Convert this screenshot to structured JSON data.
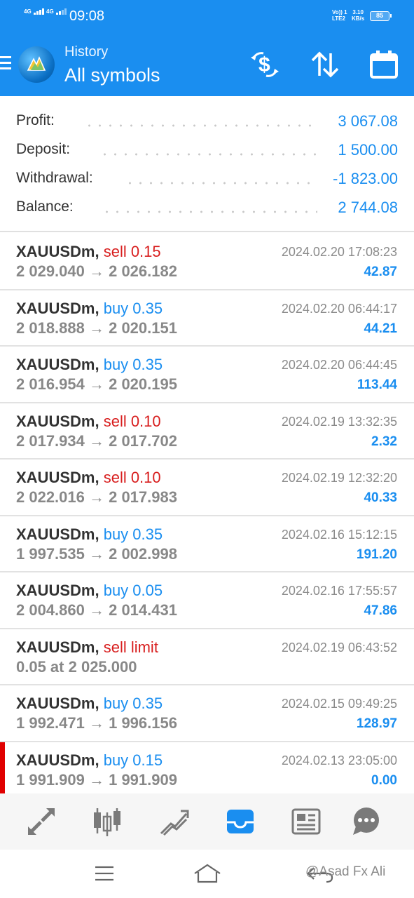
{
  "status_bar": {
    "signal1": "4G",
    "signal2": "4G",
    "time": "09:08",
    "volte": "Vo)) 1",
    "lte": "LTE2",
    "speed_value": "3.10",
    "speed_unit": "KB/s",
    "battery": "85"
  },
  "header": {
    "subtitle": "History",
    "title": "All symbols",
    "accent_color": "#1a8ef0",
    "icons": [
      "menu-icon",
      "app-logo",
      "deposit-exchange-icon",
      "sort-icon",
      "calendar-icon"
    ]
  },
  "summary": [
    {
      "label": "Profit:",
      "value": "3 067.08"
    },
    {
      "label": "Deposit:",
      "value": "1 500.00"
    },
    {
      "label": "Withdrawal:",
      "value": "-1 823.00"
    },
    {
      "label": "Balance:",
      "value": "2 744.08"
    }
  ],
  "deals": [
    {
      "symbol": "XAUUSDm,",
      "type": "sell 0.15",
      "side": "sell",
      "prices": "2 029.040 → 2 026.182",
      "time": "2024.02.20 17:08:23",
      "profit": "42.87"
    },
    {
      "symbol": "XAUUSDm,",
      "type": "buy 0.35",
      "side": "buy",
      "prices": "2 018.888 → 2 020.151",
      "time": "2024.02.20 06:44:17",
      "profit": "44.21"
    },
    {
      "symbol": "XAUUSDm,",
      "type": "buy 0.35",
      "side": "buy",
      "prices": "2 016.954 → 2 020.195",
      "time": "2024.02.20 06:44:45",
      "profit": "113.44"
    },
    {
      "symbol": "XAUUSDm,",
      "type": "sell 0.10",
      "side": "sell",
      "prices": "2 017.934 → 2 017.702",
      "time": "2024.02.19 13:32:35",
      "profit": "2.32"
    },
    {
      "symbol": "XAUUSDm,",
      "type": "sell 0.10",
      "side": "sell",
      "prices": "2 022.016 → 2 017.983",
      "time": "2024.02.19 12:32:20",
      "profit": "40.33"
    },
    {
      "symbol": "XAUUSDm,",
      "type": "buy 0.35",
      "side": "buy",
      "prices": "1 997.535 → 2 002.998",
      "time": "2024.02.16 15:12:15",
      "profit": "191.20"
    },
    {
      "symbol": "XAUUSDm,",
      "type": "buy 0.05",
      "side": "buy",
      "prices": "2 004.860 → 2 014.431",
      "time": "2024.02.16 17:55:57",
      "profit": "47.86"
    },
    {
      "symbol": "XAUUSDm,",
      "type": "sell limit",
      "side": "sell",
      "prices": "0.05 at 2 025.000",
      "time": "2024.02.19 06:43:52",
      "profit": ""
    },
    {
      "symbol": "XAUUSDm,",
      "type": "buy 0.35",
      "side": "buy",
      "prices": "1 992.471 → 1 996.156",
      "time": "2024.02.15 09:49:25",
      "profit": "128.97"
    },
    {
      "symbol": "XAUUSDm,",
      "type": "buy 0.15",
      "side": "buy",
      "prices": "1 991.909 → 1 991.909",
      "time": "2024.02.13 23:05:00",
      "profit": "0.00",
      "marked": true
    }
  ],
  "bottom_nav": {
    "items": [
      "quotes-icon",
      "chart-icon",
      "trade-icon",
      "history-icon",
      "news-icon",
      "messages-icon"
    ],
    "active": "history-icon"
  },
  "system_nav": [
    "recent-apps-icon",
    "home-icon",
    "back-icon"
  ],
  "watermark": "@Asad Fx Ali"
}
